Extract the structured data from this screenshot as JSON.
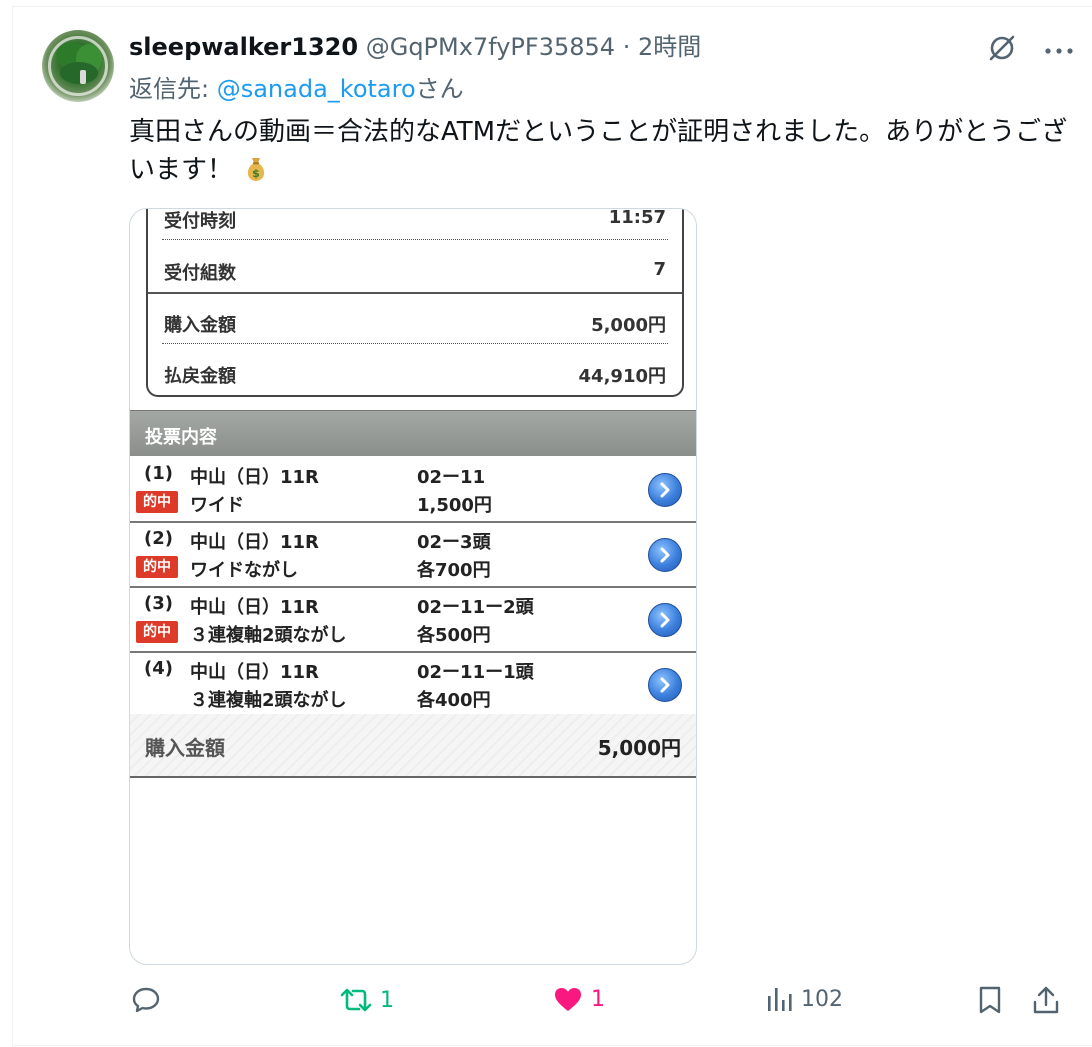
{
  "post": {
    "display_name": "sleepwalker1320",
    "handle": "@GqPMx7fyPF35854",
    "separator": "·",
    "time": "2時間",
    "reply_prefix": "返信先: ",
    "reply_mention": "@sanada_kotaro",
    "reply_suffix": "さん",
    "text": "真田さんの動画＝合法的なATMだということが証明されました。ありがとうございます！",
    "emoji_icon": "money-bag-icon"
  },
  "receipt": {
    "summary": [
      {
        "label": "受付時刻",
        "value": "11:57"
      },
      {
        "label": "受付組数",
        "value": "7"
      },
      {
        "label": "購入金額",
        "value": "5,000円"
      },
      {
        "label": "払戻金額",
        "value": "44,910円"
      }
    ],
    "section_title": "投票内容",
    "hit_label": "的中",
    "bets": [
      {
        "num": "(1)",
        "race": "中山（日）11R",
        "combo": "02ー11",
        "type": "ワイド",
        "amount": "1,500円",
        "hit": true
      },
      {
        "num": "(2)",
        "race": "中山（日）11R",
        "combo": "02ー3頭",
        "type": "ワイドながし",
        "amount": "各700円",
        "hit": true
      },
      {
        "num": "(3)",
        "race": "中山（日）11R",
        "combo": "02ー11ー2頭",
        "type": "３連複軸2頭ながし",
        "amount": "各500円",
        "hit": true
      },
      {
        "num": "(4)",
        "race": "中山（日）11R",
        "combo": "02ー11ー1頭",
        "type": "３連複軸2頭ながし",
        "amount": "各400円",
        "hit": false
      }
    ],
    "total_label": "購入金額",
    "total_value": "5,000円"
  },
  "actions": {
    "reply_count": "",
    "repost_count": "1",
    "like_count": "1",
    "views_count": "102"
  },
  "colors": {
    "link": "#1d9bf0",
    "repost_active": "#00ba7c",
    "like_active": "#f91880",
    "muted": "#536471"
  }
}
